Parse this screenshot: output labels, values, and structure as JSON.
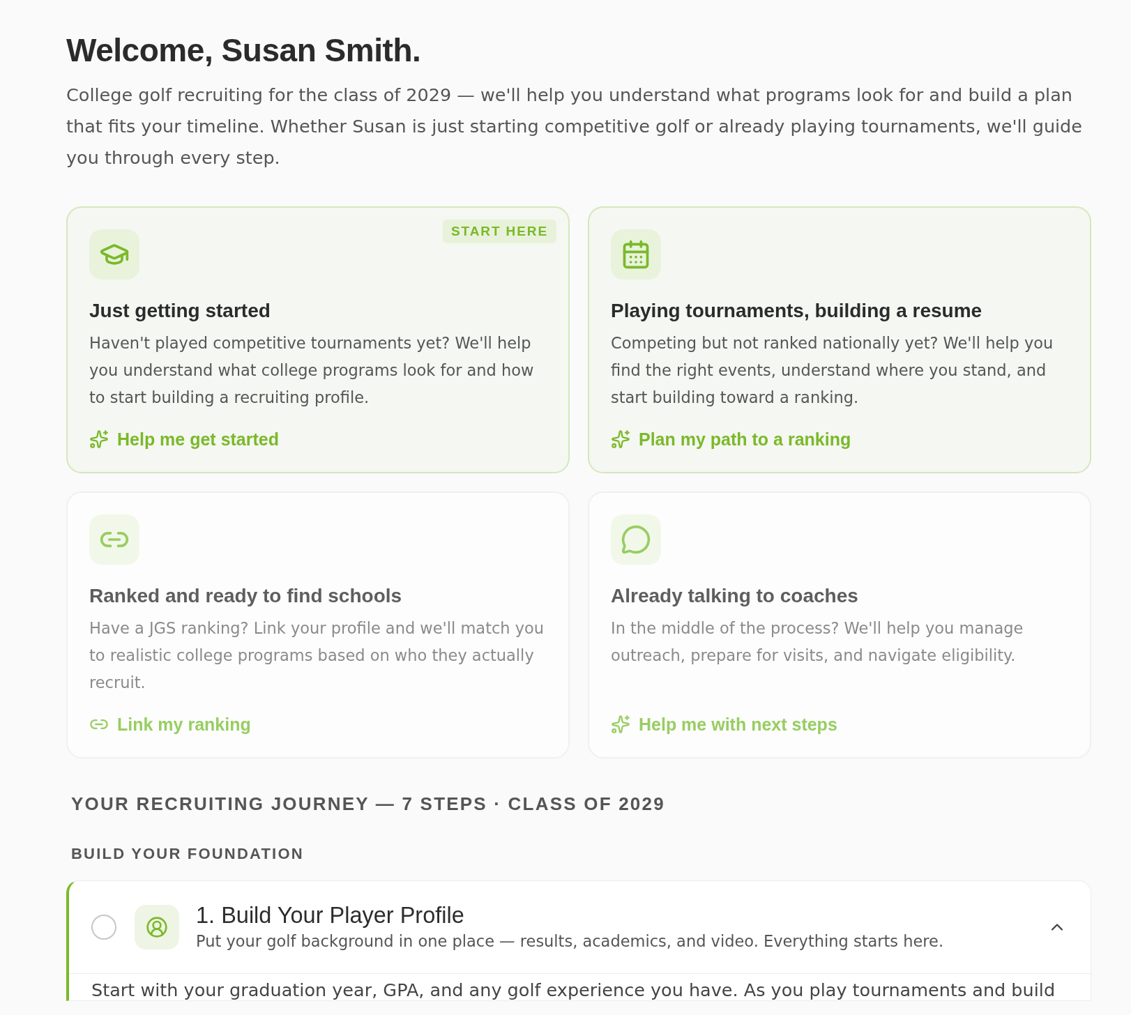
{
  "header": {
    "title": "Welcome, Susan Smith.",
    "intro": "College golf recruiting for the class of 2029 — we'll help you understand what programs look for and build a plan that fits your timeline. Whether Susan is just starting competitive golf or already playing tournaments, we'll guide you through every step."
  },
  "cards": [
    {
      "title": "Just getting started",
      "description": "Haven't played competitive tournaments yet? We'll help you understand what college programs look for and how to start building a recruiting profile.",
      "action": "Help me get started",
      "highlighted": true,
      "badge": "START HERE"
    },
    {
      "title": "Playing tournaments, building a resume",
      "description": "Competing but not ranked nationally yet? We'll help you find the right events, understand where you stand, and start building toward a ranking.",
      "action": "Plan my path to a ranking",
      "highlighted": true
    },
    {
      "title": "Ranked and ready to find schools",
      "description": "Have a JGS ranking? Link your profile and we'll match you to realistic college programs based on who they actually recruit.",
      "action": "Link my ranking",
      "highlighted": false
    },
    {
      "title": "Already talking to coaches",
      "description": "In the middle of the process? We'll help you manage outreach, prepare for visits, and navigate eligibility.",
      "action": "Help me with next steps",
      "highlighted": false
    }
  ],
  "journey": {
    "heading": "YOUR RECRUITING JOURNEY — 7 STEPS · CLASS OF 2029",
    "groups": [
      {
        "label": "BUILD YOUR FOUNDATION",
        "steps": [
          {
            "title": "1. Build Your Player Profile",
            "summary": "Put your golf background in one place — results, academics, and video. Everything starts here.",
            "details": "Start with your graduation year, GPA, and any golf experience you have. As you play tournaments and build",
            "done": false,
            "expanded": true,
            "current": true
          }
        ]
      }
    ]
  }
}
